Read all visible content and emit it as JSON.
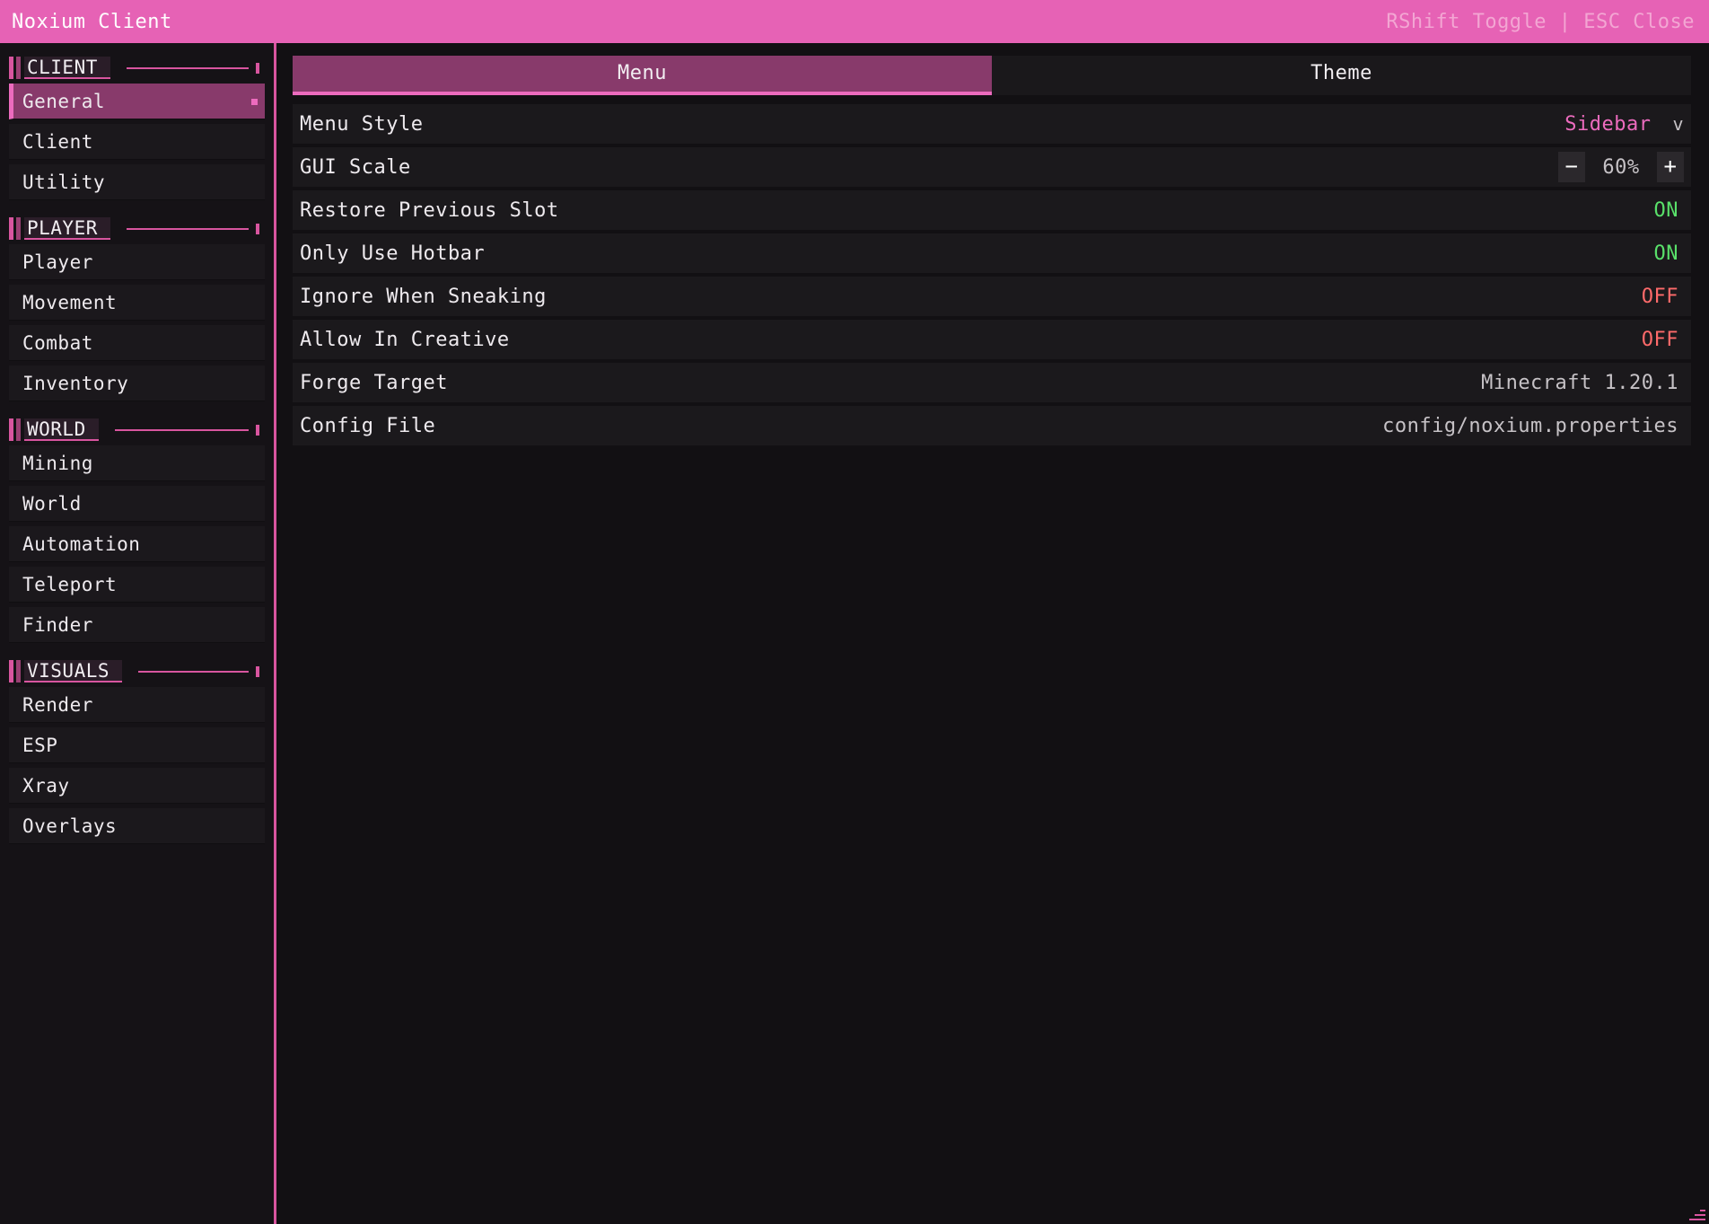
{
  "window": {
    "title": "Noxium Client",
    "hint": "RShift Toggle | ESC Close"
  },
  "sidebar": {
    "sections": [
      {
        "header": "CLIENT",
        "items": [
          "General",
          "Client",
          "Utility"
        ]
      },
      {
        "header": "PLAYER",
        "items": [
          "Player",
          "Movement",
          "Combat",
          "Inventory"
        ]
      },
      {
        "header": "WORLD",
        "items": [
          "Mining",
          "World",
          "Automation",
          "Teleport",
          "Finder"
        ]
      },
      {
        "header": "VISUALS",
        "items": [
          "Render",
          "ESP",
          "Xray",
          "Overlays"
        ]
      }
    ],
    "active_item": "General"
  },
  "tabs": [
    {
      "label": "Menu",
      "active": true
    },
    {
      "label": "Theme",
      "active": false
    }
  ],
  "settings": [
    {
      "label": "Menu Style",
      "value": "Sidebar",
      "kind": "dropdown",
      "chevron": "v"
    },
    {
      "label": "GUI Scale",
      "value": "60%",
      "kind": "stepper",
      "minus": "−",
      "plus": "+"
    },
    {
      "label": "Restore Previous Slot",
      "value": "ON",
      "kind": "toggle"
    },
    {
      "label": "Only Use Hotbar",
      "value": "ON",
      "kind": "toggle"
    },
    {
      "label": "Ignore When Sneaking",
      "value": "OFF",
      "kind": "toggle"
    },
    {
      "label": "Allow In Creative",
      "value": "OFF",
      "kind": "toggle"
    },
    {
      "label": "Forge Target",
      "value": "Minecraft 1.20.1",
      "kind": "text"
    },
    {
      "label": "Config File",
      "value": "config/noxium.properties",
      "kind": "text"
    }
  ],
  "colors": {
    "accent": "#ec6bbe",
    "titlebar": "#e662b5",
    "on": "#59e06a",
    "off": "#ff6a6a"
  },
  "icons": [
    "chevron-down-icon",
    "minus-icon",
    "plus-icon",
    "resize-grip-icon"
  ]
}
